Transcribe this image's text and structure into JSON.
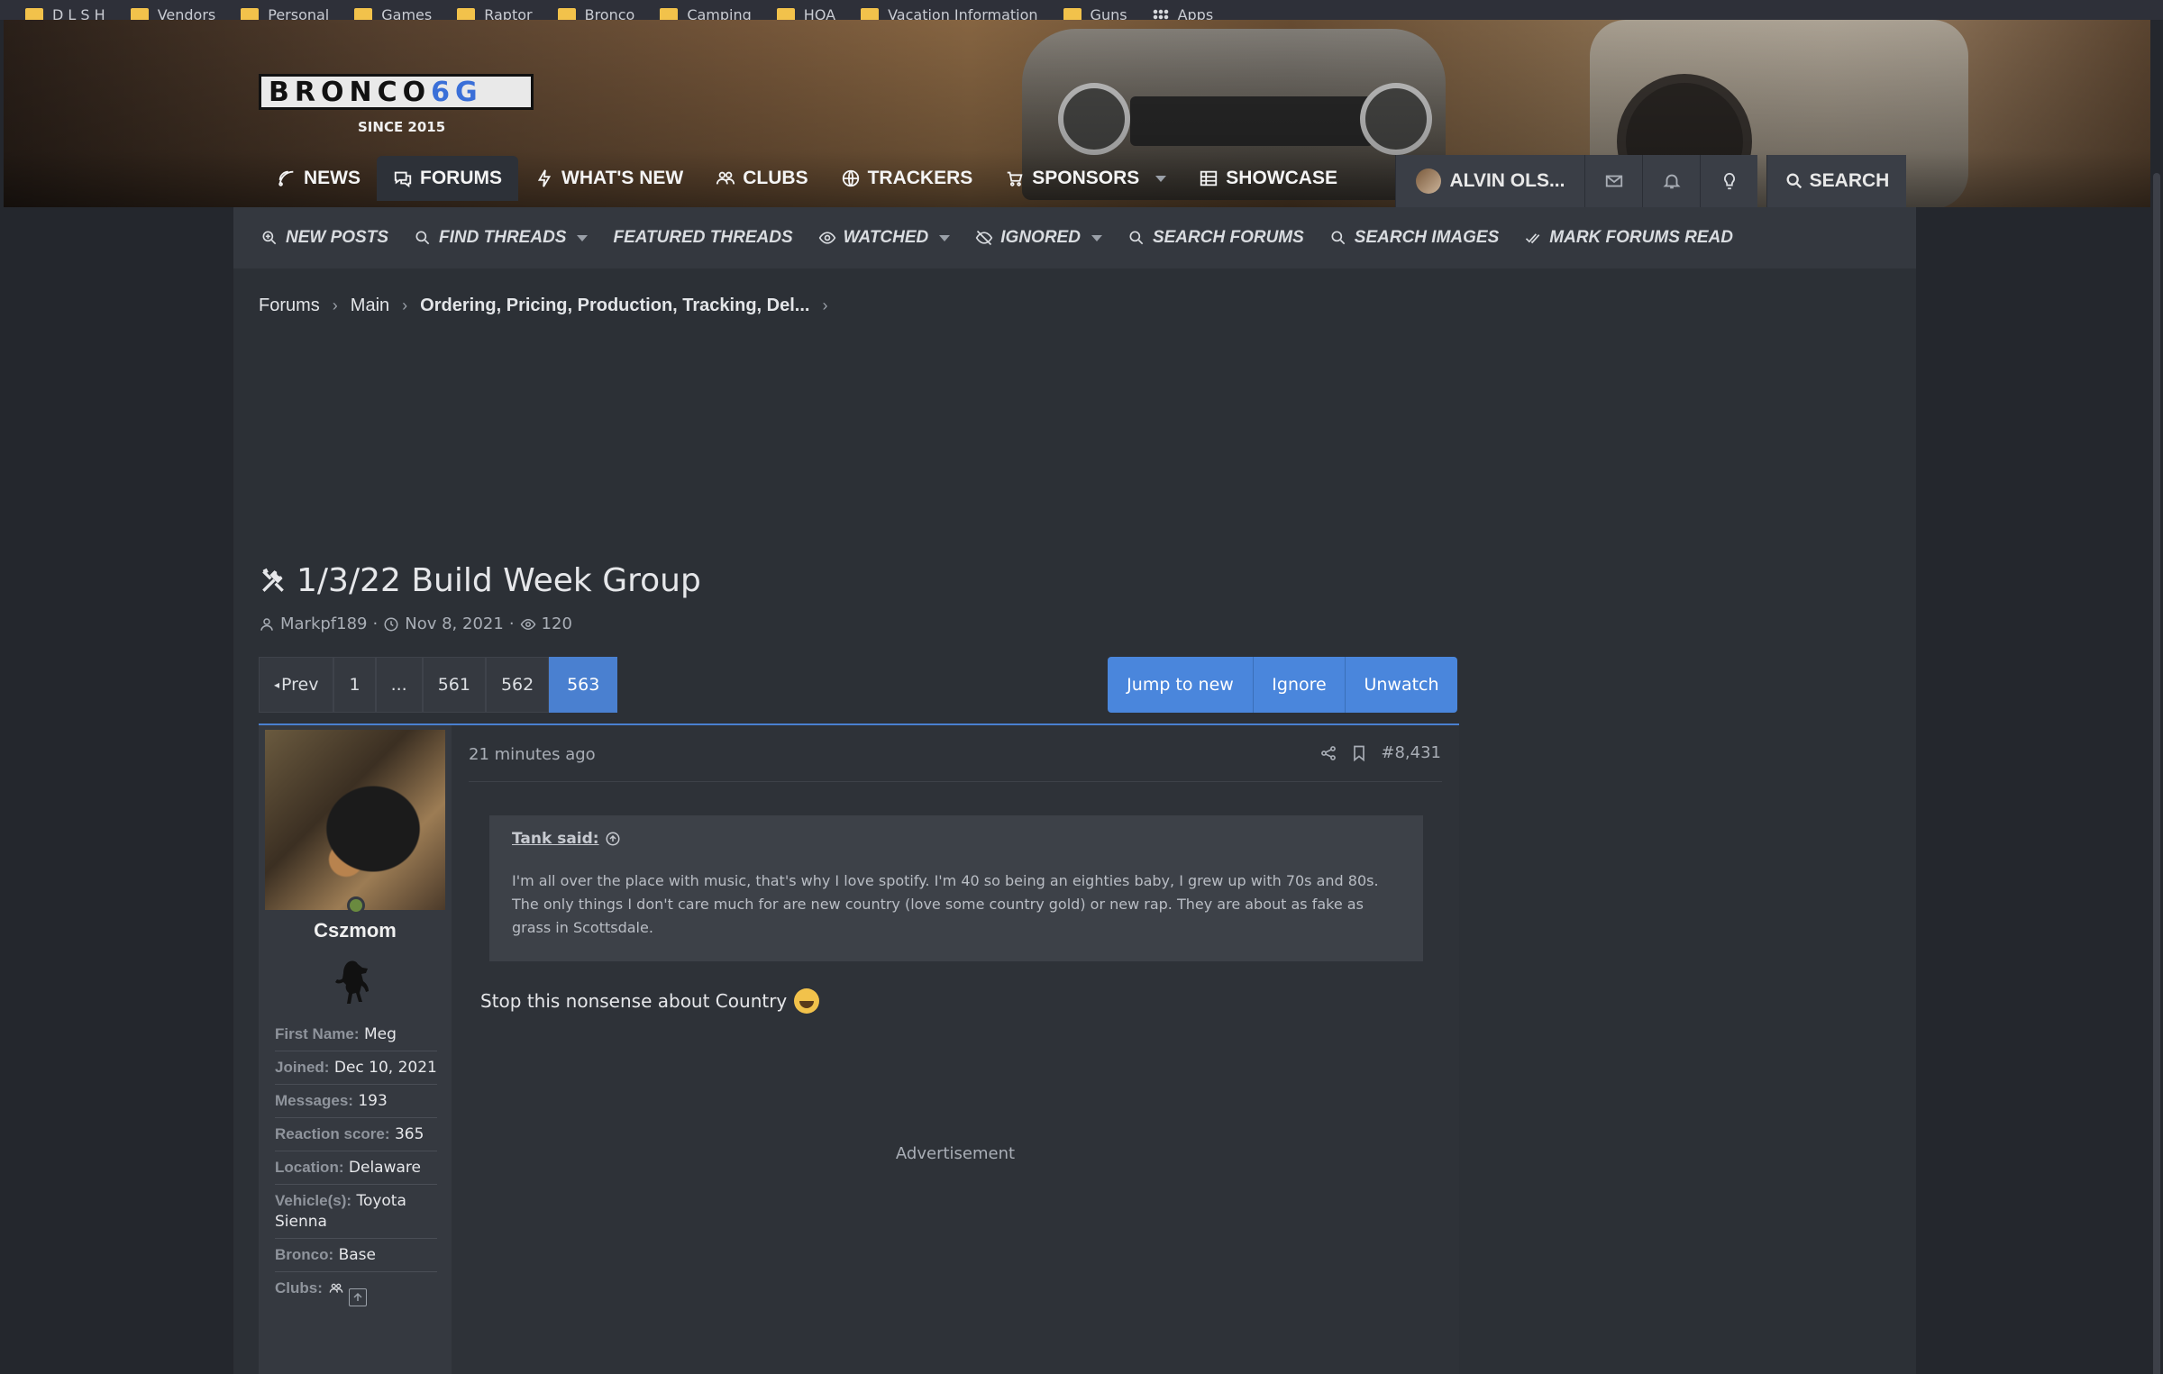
{
  "bookmarks": [
    "D L S H",
    "Vendors",
    "Personal",
    "Games",
    "Raptor",
    "Bronco",
    "Camping",
    "HOA",
    "Vacation Information",
    "Guns",
    "Apps"
  ],
  "site": {
    "logo_text": "BRONCO",
    "logo_6g": "6G",
    "logo_tagline": "SINCE 2015"
  },
  "main_nav": [
    {
      "label": "NEWS",
      "icon": "news-icon"
    },
    {
      "label": "FORUMS",
      "icon": "forums-icon",
      "active": true
    },
    {
      "label": "WHAT'S NEW",
      "icon": "bolt-icon"
    },
    {
      "label": "CLUBS",
      "icon": "clubs-icon"
    },
    {
      "label": "TRACKERS",
      "icon": "globe-icon"
    },
    {
      "label": "SPONSORS",
      "icon": "cart-icon"
    },
    {
      "label": "SHOWCASE",
      "icon": "table-icon"
    }
  ],
  "user_nav": {
    "username": "ALVIN OLS...",
    "search_label": "SEARCH"
  },
  "sub_nav": [
    {
      "label": "NEW POSTS",
      "icon": "search-plus-icon"
    },
    {
      "label": "FIND THREADS",
      "icon": "search-icon",
      "dropdown": true
    },
    {
      "label": "FEATURED THREADS"
    },
    {
      "label": "WATCHED",
      "icon": "eye-icon",
      "dropdown": true
    },
    {
      "label": "IGNORED",
      "icon": "eye-slash-icon",
      "dropdown": true
    },
    {
      "label": "SEARCH FORUMS",
      "icon": "search-icon"
    },
    {
      "label": "SEARCH IMAGES",
      "icon": "search-icon"
    },
    {
      "label": "MARK FORUMS READ",
      "icon": "check-double-icon"
    }
  ],
  "breadcrumb": [
    "Forums",
    "Main",
    "Ordering, Pricing, Production, Tracking, Del..."
  ],
  "thread": {
    "title": "1/3/22 Build Week Group",
    "author": "Markpf189",
    "date": "Nov 8, 2021",
    "views": "120"
  },
  "pagination": {
    "prev_label": "Prev",
    "pages": [
      "1",
      "...",
      "561",
      "562",
      "563"
    ],
    "current": "563"
  },
  "thread_actions": {
    "jump": "Jump to new",
    "ignore": "Ignore",
    "unwatch": "Unwatch"
  },
  "post": {
    "time": "21 minutes ago",
    "number": "#8,431",
    "quote_author": "Tank said:",
    "quote_text": "I'm all over the place with music, that's why I love spotify. I'm 40 so being an eighties baby, I grew up with 70s and 80s. The only things I don't care much for are new country (love some country gold) or new rap. They are about as fake as grass in Scottsdale.",
    "body": "Stop this nonsense about Country",
    "advertisement": "Advertisement"
  },
  "poster": {
    "name": "Cszmom",
    "fields": [
      {
        "k": "First Name:",
        "v": "Meg"
      },
      {
        "k": "Joined:",
        "v": "Dec 10, 2021"
      },
      {
        "k": "Messages:",
        "v": "193"
      },
      {
        "k": "Reaction score:",
        "v": "365"
      },
      {
        "k": "Location:",
        "v": "Delaware"
      },
      {
        "k": "Vehicle(s):",
        "v": "Toyota Sienna"
      },
      {
        "k": "Bronco:",
        "v": "Base"
      },
      {
        "k": "Clubs:",
        "v": ""
      }
    ]
  },
  "colors": {
    "accent": "#4a86dc",
    "page_bg": "#2c3036",
    "sub_nav_bg": "#34383f"
  }
}
